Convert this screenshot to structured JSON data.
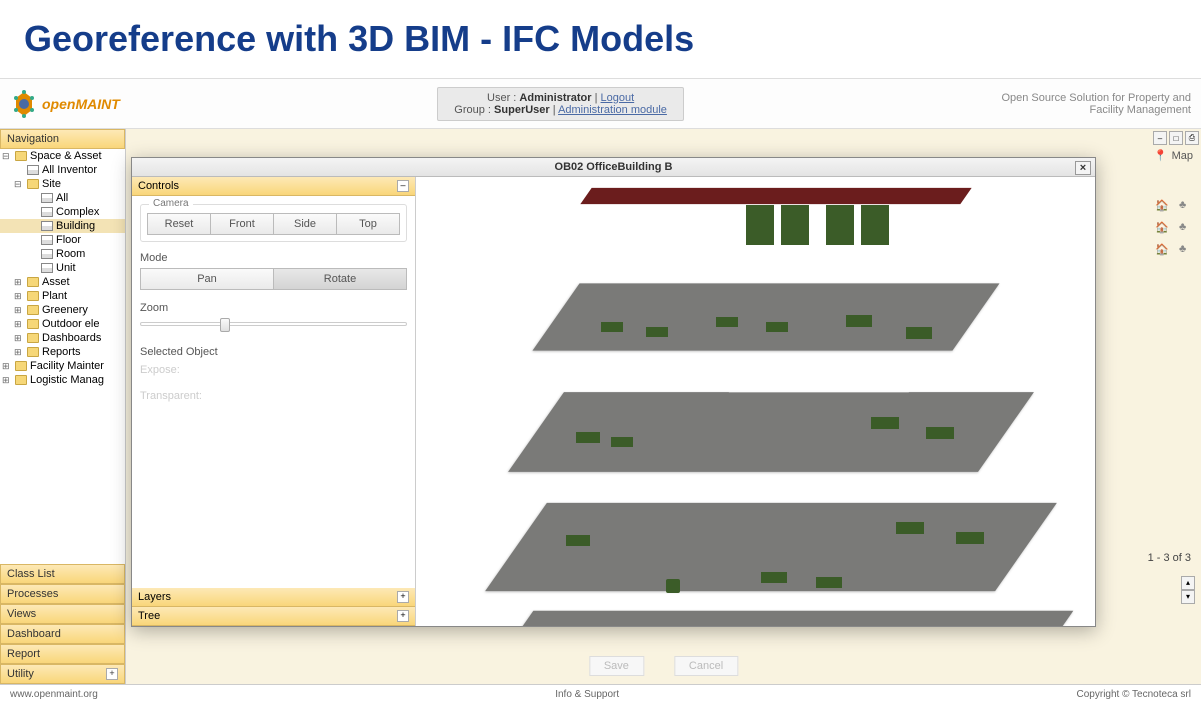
{
  "page_title": "Georeference with 3D BIM - IFC Models",
  "logo_text": "openMAINT",
  "user_box": {
    "user_label": "User :",
    "user_name": "Administrator",
    "logout": "Logout",
    "group_label": "Group :",
    "group_name": "SuperUser",
    "admin_link": "Administration module"
  },
  "tagline_line1": "Open Source Solution for Property and",
  "tagline_line2": "Facility Management",
  "nav": {
    "header": "Navigation",
    "items": [
      {
        "label": "Space & Asset",
        "type": "folder",
        "expanded": true,
        "indent": 0
      },
      {
        "label": "All Inventor",
        "type": "grid",
        "indent": 1
      },
      {
        "label": "Site",
        "type": "folder",
        "expanded": true,
        "indent": 1
      },
      {
        "label": "All",
        "type": "grid",
        "indent": 2
      },
      {
        "label": "Complex",
        "type": "grid",
        "indent": 2
      },
      {
        "label": "Building",
        "type": "grid",
        "indent": 2,
        "selected": true
      },
      {
        "label": "Floor",
        "type": "grid",
        "indent": 2
      },
      {
        "label": "Room",
        "type": "grid",
        "indent": 2
      },
      {
        "label": "Unit",
        "type": "grid",
        "indent": 2
      },
      {
        "label": "Asset",
        "type": "folder",
        "indent": 1
      },
      {
        "label": "Plant",
        "type": "folder",
        "indent": 1
      },
      {
        "label": "Greenery",
        "type": "folder",
        "indent": 1
      },
      {
        "label": "Outdoor ele",
        "type": "folder",
        "indent": 1
      },
      {
        "label": "Dashboards",
        "type": "folder",
        "indent": 1
      },
      {
        "label": "Reports",
        "type": "folder",
        "indent": 1
      },
      {
        "label": "Facility Mainter",
        "type": "folder",
        "indent": 0
      },
      {
        "label": "Logistic Manag",
        "type": "folder",
        "indent": 0
      }
    ],
    "accordions": [
      "Class List",
      "Processes",
      "Views",
      "Dashboard",
      "Report",
      "Utility"
    ]
  },
  "content": {
    "map_label": "Map",
    "pager": "1 - 3 of 3",
    "save": "Save",
    "cancel": "Cancel"
  },
  "modal": {
    "title": "OB02 OfficeBuilding B",
    "controls_title": "Controls",
    "camera_label": "Camera",
    "camera_buttons": [
      "Reset",
      "Front",
      "Side",
      "Top"
    ],
    "mode_label": "Mode",
    "mode_buttons": [
      "Pan",
      "Rotate"
    ],
    "mode_active": 1,
    "zoom_label": "Zoom",
    "selected_label": "Selected Object",
    "expose_label": "Expose:",
    "transparent_label": "Transparent:",
    "layers_title": "Layers",
    "tree_title": "Tree"
  },
  "footer": {
    "left": "www.openmaint.org",
    "center": "Info & Support",
    "right": "Copyright © Tecnoteca srl"
  }
}
